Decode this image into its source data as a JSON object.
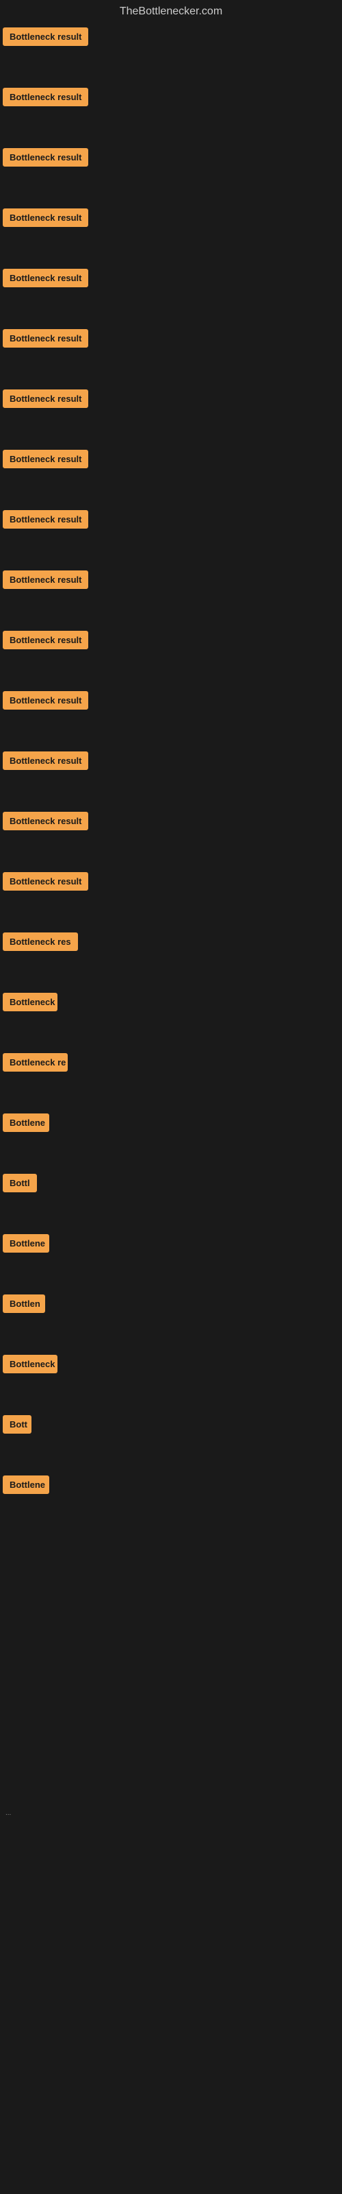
{
  "header": {
    "title": "TheBottlenecker.com"
  },
  "items": [
    {
      "label": "Bottleneck result",
      "width": 130
    },
    {
      "label": "Bottleneck result",
      "width": 130
    },
    {
      "label": "Bottleneck result",
      "width": 130
    },
    {
      "label": "Bottleneck result",
      "width": 130
    },
    {
      "label": "Bottleneck result",
      "width": 130
    },
    {
      "label": "Bottleneck result",
      "width": 130
    },
    {
      "label": "Bottleneck result",
      "width": 130
    },
    {
      "label": "Bottleneck result",
      "width": 130
    },
    {
      "label": "Bottleneck result",
      "width": 130
    },
    {
      "label": "Bottleneck result",
      "width": 130
    },
    {
      "label": "Bottleneck result",
      "width": 130
    },
    {
      "label": "Bottleneck result",
      "width": 130
    },
    {
      "label": "Bottleneck result",
      "width": 130
    },
    {
      "label": "Bottleneck result",
      "width": 130
    },
    {
      "label": "Bottleneck result",
      "width": 130
    },
    {
      "label": "Bottleneck res",
      "width": 110
    },
    {
      "label": "Bottleneck",
      "width": 80
    },
    {
      "label": "Bottleneck re",
      "width": 95
    },
    {
      "label": "Bottlene",
      "width": 68
    },
    {
      "label": "Bottl",
      "width": 50
    },
    {
      "label": "Bottlene",
      "width": 68
    },
    {
      "label": "Bottlen",
      "width": 62
    },
    {
      "label": "Bottleneck",
      "width": 80
    },
    {
      "label": "Bott",
      "width": 42
    },
    {
      "label": "Bottlene",
      "width": 68
    }
  ],
  "ellipsis": "..."
}
